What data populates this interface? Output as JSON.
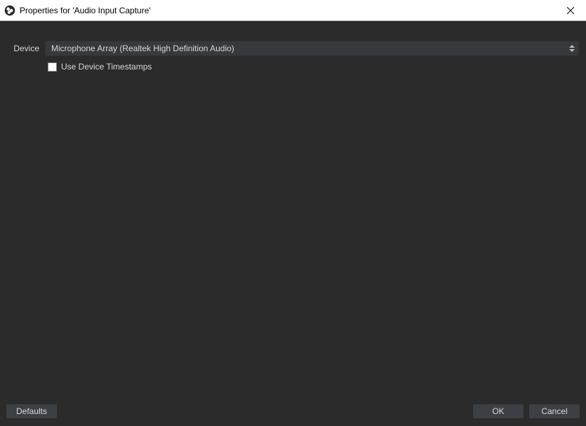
{
  "titlebar": {
    "title": "Properties for 'Audio Input Capture'"
  },
  "form": {
    "device_label": "Device",
    "device_value": "Microphone Array (Realtek High Definition Audio)",
    "use_timestamps_label": "Use Device Timestamps",
    "use_timestamps_checked": false
  },
  "buttons": {
    "defaults": "Defaults",
    "ok": "OK",
    "cancel": "Cancel"
  }
}
